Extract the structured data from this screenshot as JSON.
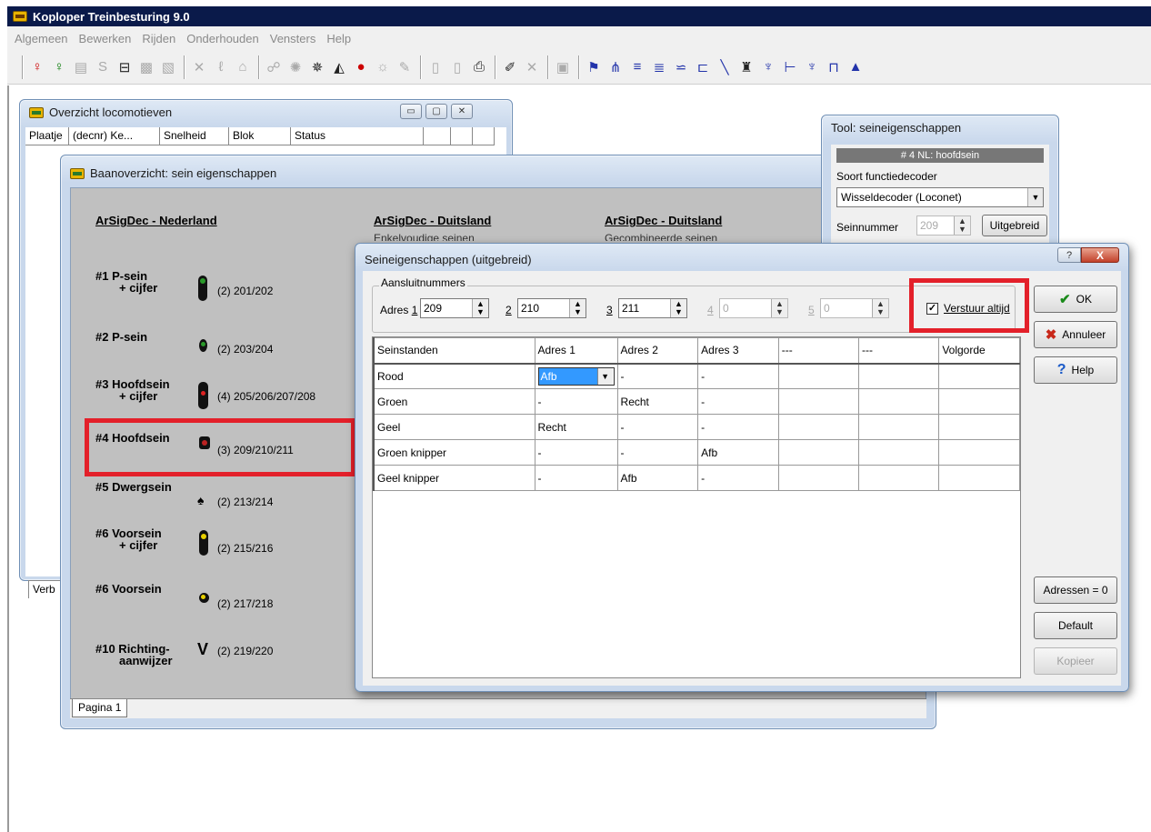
{
  "app": {
    "title": "Koploper Treinbesturing 9.0",
    "menu": [
      "Algemeen",
      "Bewerken",
      "Rijden",
      "Onderhouden",
      "Vensters",
      "Help"
    ]
  },
  "toolbar": {
    "icons": [
      "signal-red-icon",
      "signal-green-icon",
      "loco-icon",
      "s-icon",
      "grid-icon",
      "image-icon",
      "image2-icon",
      "cross-icon",
      "tool-icon",
      "bell-icon",
      "network-icon",
      "gear-icon",
      "speaker-icon",
      "loco-black-icon",
      "red-dot-icon",
      "sun-icon",
      "wrench-icon",
      "page-icon",
      "page2-icon",
      "printer-icon",
      "pencil-icon",
      "close-icon",
      "save-icon",
      "flag-icon",
      "switch-icon",
      "track-icon",
      "track2-icon",
      "track3-icon",
      "block-icon",
      "line-icon",
      "signal-icon",
      "signal2-icon",
      "junction-icon",
      "signal3-icon",
      "signal4-icon",
      "triangle-icon"
    ]
  },
  "overzicht": {
    "title": "Overzicht locomotieven",
    "columns": [
      "Plaatje",
      "(decnr) Ke...",
      "Snelheid",
      "Blok",
      "Status",
      "",
      "",
      ""
    ],
    "tab": "Verb"
  },
  "baan": {
    "title": "Baanoverzicht: sein eigenschappen",
    "col1_title": "ArSigDec - Nederland",
    "col2_title": "ArSigDec - Duitsland",
    "col2_sub": "Enkelvoudige seinen",
    "col3_title": "ArSigDec - Duitsland",
    "col3_sub": "Gecombineerde seinen",
    "seinen": [
      {
        "label": "#1  P-sein",
        "sub": "+ cijfer",
        "addr": "(2)  201/202"
      },
      {
        "label": "#2  P-sein",
        "sub": "",
        "addr": "(2)  203/204"
      },
      {
        "label": "#3  Hoofdsein",
        "sub": "+ cijfer",
        "addr": "(4)  205/206/207/208"
      },
      {
        "label": "#4  Hoofdsein",
        "sub": "",
        "addr": "(3)  209/210/211"
      },
      {
        "label": "#5  Dwergsein",
        "sub": "",
        "addr": "(2)  213/214"
      },
      {
        "label": "#6  Voorsein",
        "sub": "+ cijfer",
        "addr": "(2)  215/216"
      },
      {
        "label": "#6  Voorsein",
        "sub": "",
        "addr": "(2)  217/218"
      },
      {
        "label": "#10 Richting-",
        "sub": "aanwijzer",
        "addr": "(2)  219/220"
      }
    ],
    "page_tab": "Pagina 1"
  },
  "tool": {
    "title": "Tool: seineigenschappen",
    "header": "# 4 NL: hoofdsein",
    "type_label": "Soort functiedecoder",
    "type_value": "Wisseldecoder (Loconet)",
    "seinnummer_label": "Seinnummer",
    "seinnummer_value": "209",
    "uitgebreid_button": "Uitgebreid"
  },
  "dialog": {
    "title": "Seineigenschappen (uitgebreid)",
    "help_glyph": "?",
    "close_glyph": "X",
    "group_title": "Aansluitnummers",
    "addr_prefix": "Adres",
    "addresses": [
      {
        "label": "1",
        "value": "209",
        "enabled": true
      },
      {
        "label": "2",
        "value": "210",
        "enabled": true
      },
      {
        "label": "3",
        "value": "211",
        "enabled": true
      },
      {
        "label": "4",
        "value": "0",
        "enabled": false
      },
      {
        "label": "5",
        "value": "0",
        "enabled": false
      }
    ],
    "verstuur_label": "Verstuur altijd",
    "verstuur_checked": true,
    "grid_headers": [
      "Seinstanden",
      "Adres 1",
      "Adres 2",
      "Adres 3",
      "---",
      "---",
      "Volgorde"
    ],
    "grid_rows": [
      [
        "Rood",
        "Afb",
        "-",
        "-",
        "",
        "",
        ""
      ],
      [
        "Groen",
        "-",
        "Recht",
        "-",
        "",
        "",
        ""
      ],
      [
        "Geel",
        "Recht",
        "-",
        "-",
        "",
        "",
        ""
      ],
      [
        "Groen knipper",
        "-",
        "-",
        "Afb",
        "",
        "",
        ""
      ],
      [
        "Geel knipper",
        "-",
        "Afb",
        "-",
        "",
        "",
        ""
      ]
    ],
    "buttons": {
      "ok": "OK",
      "annuleer": "Annuleer",
      "help": "Help",
      "adressen": "Adressen = 0",
      "default": "Default",
      "kopieer": "Kopieer"
    }
  }
}
